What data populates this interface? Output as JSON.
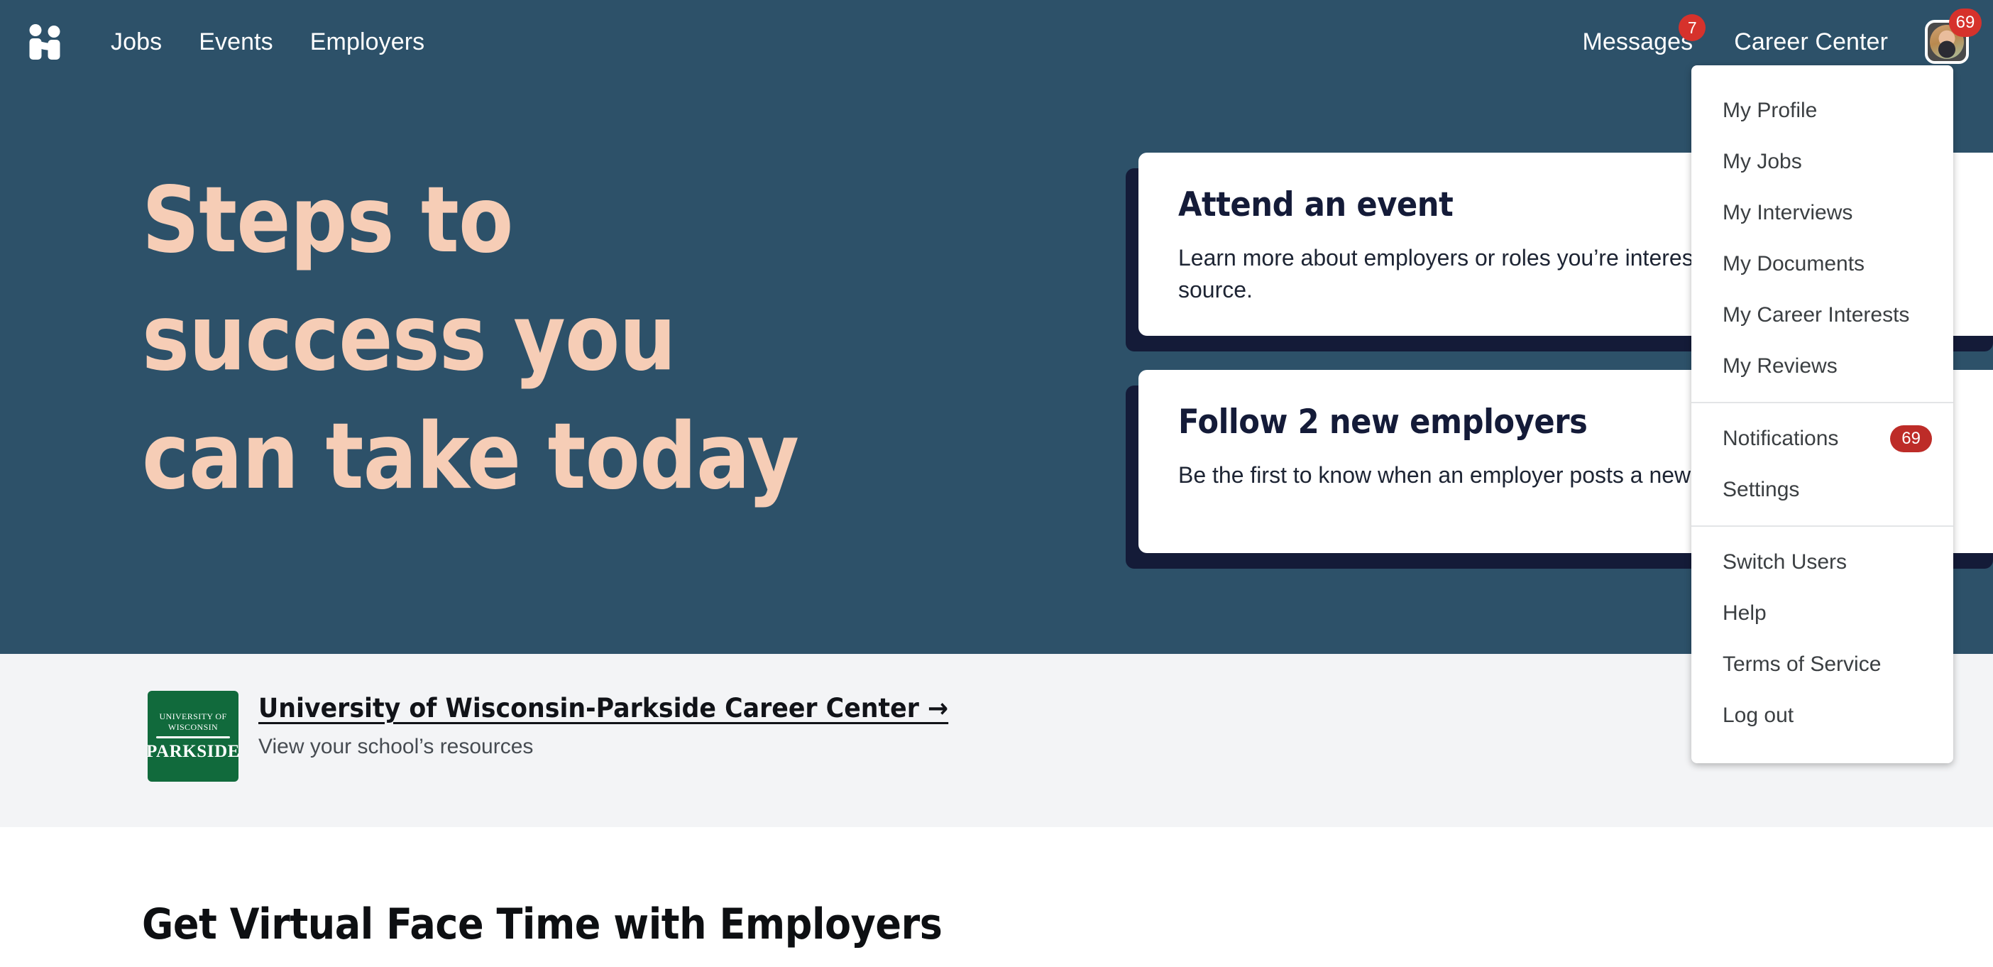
{
  "nav": {
    "logo_icon": "handshake-logo-icon",
    "left_links": [
      {
        "label": "Jobs"
      },
      {
        "label": "Events"
      },
      {
        "label": "Employers"
      }
    ],
    "messages": {
      "label": "Messages",
      "badge": "7"
    },
    "career_center": {
      "label": "Career Center"
    },
    "avatar": {
      "name": "user-avatar",
      "badge": "69"
    }
  },
  "dropdown": {
    "groups": [
      {
        "items": [
          {
            "label": "My Profile"
          },
          {
            "label": "My Jobs"
          },
          {
            "label": "My Interviews"
          },
          {
            "label": "My Documents"
          },
          {
            "label": "My Career Interests"
          },
          {
            "label": "My Reviews"
          }
        ]
      },
      {
        "items": [
          {
            "label": "Notifications",
            "badge": "69"
          },
          {
            "label": "Settings"
          }
        ]
      },
      {
        "items": [
          {
            "label": "Switch Users"
          },
          {
            "label": "Help"
          },
          {
            "label": "Terms of Service"
          },
          {
            "label": "Log out"
          }
        ]
      }
    ]
  },
  "hero": {
    "title_line1": "Steps to",
    "title_line2": "success you",
    "title_line3": "can take today",
    "cards": [
      {
        "title": "Attend an event",
        "desc": "Learn more about employers or roles you’re interested in, directly from the source."
      },
      {
        "title": "Follow 2 new employers",
        "desc": "Be the first to know when an employer posts a new job or hosts an event."
      }
    ]
  },
  "banner": {
    "logo": {
      "line1": "UNIVERSITY OF",
      "line2": "WISCONSIN",
      "main": "PARKSIDE"
    },
    "link": "University of Wisconsin-Parkside Career Center →",
    "subtitle": "View your school’s resources"
  },
  "bottom_section": {
    "title": "Get Virtual Face Time with Employers"
  },
  "colors": {
    "hero_bg": "#2d5169",
    "hero_title": "#f6cdb6",
    "card_shadow": "#141b38",
    "badge_red": "#d6322c",
    "banner_bg": "#f3f4f6",
    "school_green": "#116a3c"
  }
}
